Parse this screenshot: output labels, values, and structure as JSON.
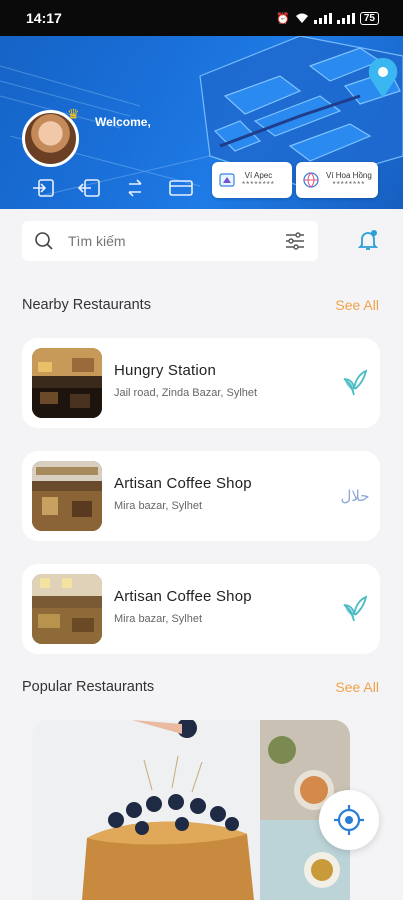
{
  "status_bar": {
    "time": "14:17",
    "battery": "75"
  },
  "header": {
    "welcome": "Welcome,",
    "wallets": [
      {
        "label": "Ví Apec",
        "sub": "********"
      },
      {
        "label": "Ví Hoa Hồng",
        "sub": "********"
      }
    ]
  },
  "search": {
    "placeholder": "Tìm kiếm"
  },
  "nearby": {
    "title": "Nearby Restaurants",
    "see_all": "See All",
    "items": [
      {
        "name": "Hungry Station",
        "address": "Jail road, Zinda Bazar, Sylhet",
        "badge": "leaf-icon"
      },
      {
        "name": "Artisan Coffee Shop",
        "address": "Mira bazar, Sylhet",
        "badge": "halal-icon",
        "badge_text": "حلال"
      },
      {
        "name": "Artisan Coffee Shop",
        "address": "Mira bazar, Sylhet",
        "badge": "leaf-icon"
      }
    ]
  },
  "popular": {
    "title": "Popular Restaurants",
    "see_all": "See All"
  },
  "colors": {
    "accent": "#f0a24a",
    "brand_blue": "#1a6fd8",
    "leaf": "#4bbcc4"
  }
}
